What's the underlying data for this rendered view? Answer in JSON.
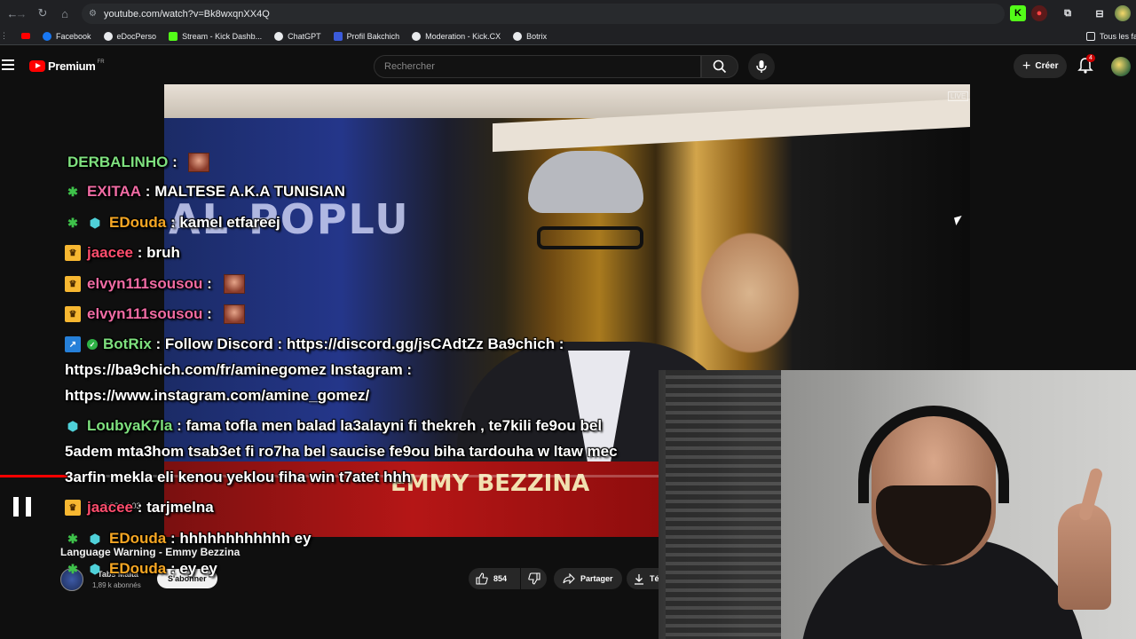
{
  "browser": {
    "url": "youtube.com/watch?v=Bk8wxqnXX4Q",
    "bookmarks": [
      {
        "label": "Facebook",
        "color": "#1877f2"
      },
      {
        "label": "eDocPerso",
        "color": "#e8eaed"
      },
      {
        "label": "Stream - Kick Dashb...",
        "color": "#53fc18"
      },
      {
        "label": "ChatGPT",
        "color": "#e8eaed"
      },
      {
        "label": "Profil Bakchich",
        "color": "#3b5bdb"
      },
      {
        "label": "Moderation - Kick.CX",
        "color": "#e8eaed"
      },
      {
        "label": "Botrix",
        "color": "#e8eaed"
      }
    ],
    "all_bookmarks_label": "Tous les fav"
  },
  "youtube": {
    "logo_text": "Premium",
    "logo_region": "FR",
    "search_placeholder": "Rechercher",
    "create_label": "Créer",
    "notification_count": "4",
    "video_overlay_text": "AL-POPLU",
    "video_banner_text": "EMMY BEZZINA",
    "video_live_mark": "LIVE",
    "time_display": "0:26 / 4:03",
    "progress_fraction": 0.11,
    "title": "Language Warning - Emmy Bezzina",
    "channel_name": "Tabs Malta",
    "subscribers": "1,89 k abonnés",
    "subscribe_label": "S'abonner",
    "likes": "854",
    "share_label": "Partager",
    "download_label": "Télécharger"
  },
  "chat": {
    "messages": [
      {
        "user": "DERBALINHO",
        "user_color": "#7ee07e",
        "badges": [],
        "text": "",
        "emote": true
      },
      {
        "user": "EXITAA",
        "user_color": "#f06ba3",
        "badges": [
          "weed"
        ],
        "text": "MALTESE A.K.A TUNISIAN",
        "emote": false
      },
      {
        "user": "EDouda",
        "user_color": "#f5a623",
        "badges": [
          "weed",
          "gift"
        ],
        "text": "kamel etfareej",
        "emote": false
      },
      {
        "user": "jaacee",
        "user_color": "#ff4d6d",
        "badges": [
          "crown"
        ],
        "text": "bruh",
        "emote": false
      },
      {
        "user": "elvyn111sousou",
        "user_color": "#f06ba3",
        "badges": [
          "crown"
        ],
        "text": "",
        "emote": true
      },
      {
        "user": "elvyn111sousou",
        "user_color": "#f06ba3",
        "badges": [
          "crown"
        ],
        "text": "",
        "emote": true
      },
      {
        "user": "BotRix",
        "user_color": "#7ee07e",
        "badges": [
          "bot",
          "check"
        ],
        "text": "Follow Discord : https://discord.gg/jsCAdtZz Ba9chich :",
        "emote": false
      },
      {
        "user": "",
        "user_color": "#ffffff",
        "badges": [],
        "text": "https://ba9chich.com/fr/aminegomez Instagram :",
        "emote": false
      },
      {
        "user": "",
        "user_color": "#ffffff",
        "badges": [],
        "text": "https://www.instagram.com/amine_gomez/",
        "emote": false
      },
      {
        "user": "LoubyaK7la",
        "user_color": "#7ee07e",
        "badges": [
          "gift"
        ],
        "text": "fama tofla men balad la3alayni fi thekreh , te7kili fe9ou bel",
        "emote": false
      },
      {
        "user": "",
        "user_color": "#ffffff",
        "badges": [],
        "text": "5adem mta3hom tsab3et fi ro7ha bel saucise fe9ou biha tardouha w ltaw mec",
        "emote": false
      },
      {
        "user": "",
        "user_color": "#ffffff",
        "badges": [],
        "text": "3arfin mekla eli kenou yeklou fiha win t7atet hhh",
        "emote": false
      },
      {
        "user": "jaacee",
        "user_color": "#ff4d6d",
        "badges": [
          "crown"
        ],
        "text": "tarjmelna",
        "emote": false
      },
      {
        "user": "EDouda",
        "user_color": "#f5a623",
        "badges": [
          "weed",
          "gift"
        ],
        "text": "hhhhhhhhhhhh ey",
        "emote": false
      },
      {
        "user": "EDouda",
        "user_color": "#f5a623",
        "badges": [
          "weed",
          "gift"
        ],
        "text": "ey ey",
        "emote": false
      }
    ]
  }
}
